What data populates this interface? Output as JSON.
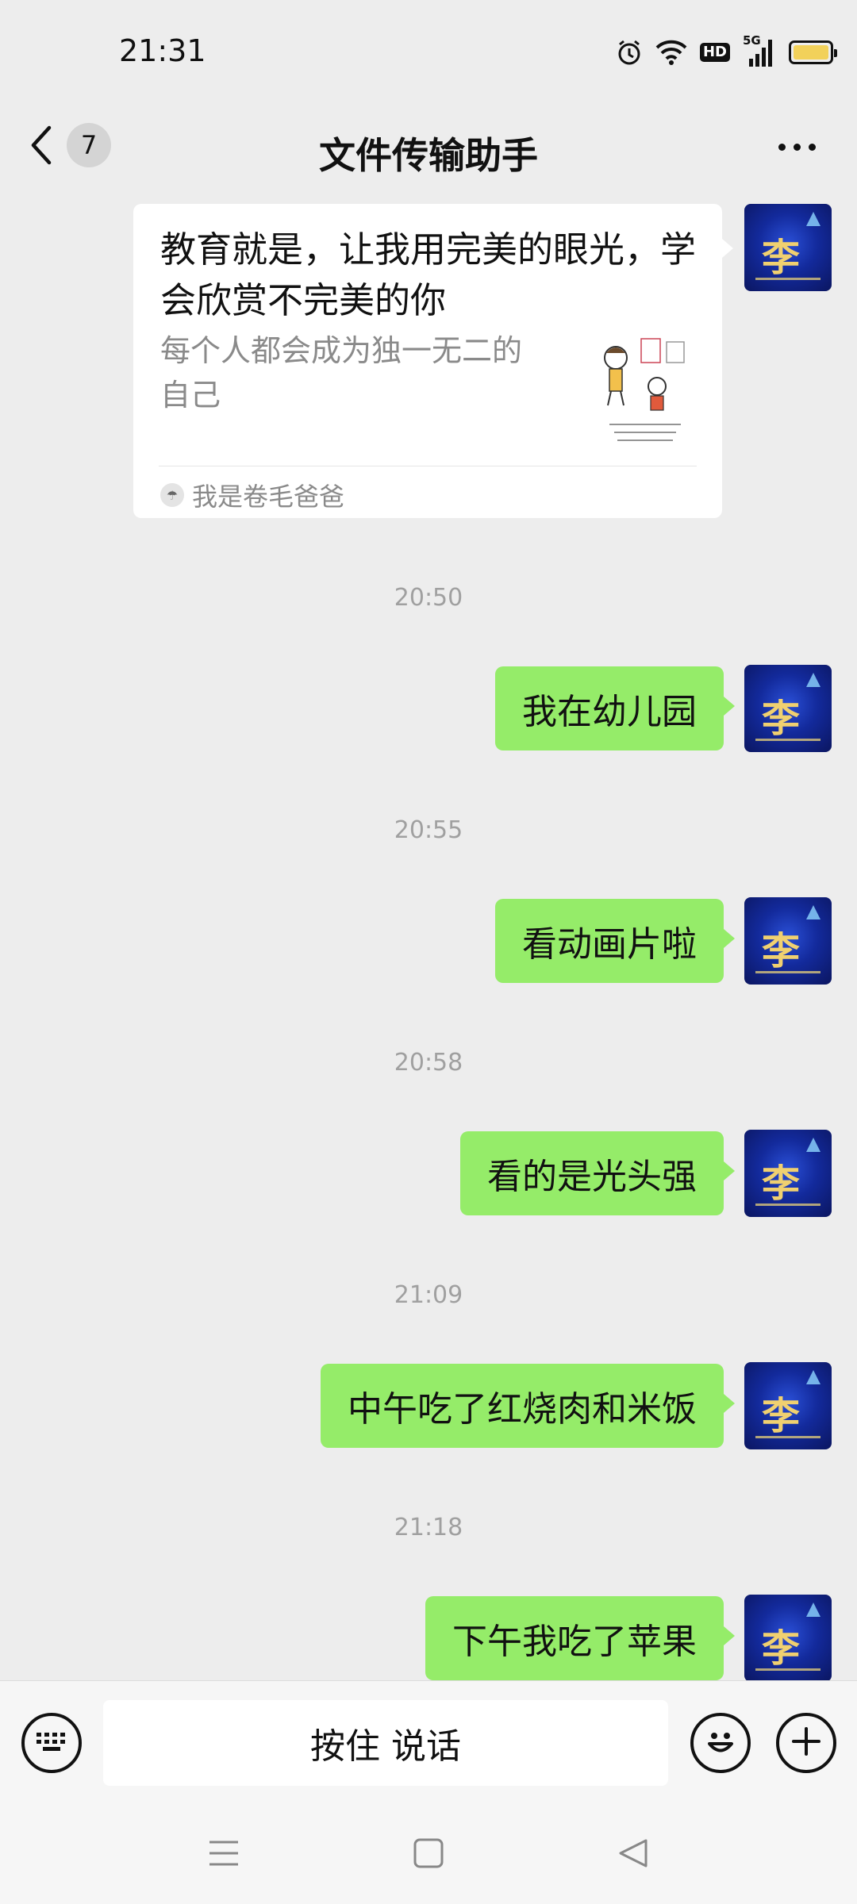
{
  "status_bar": {
    "time": "21:31",
    "hd_label": "HD",
    "network_label": "5G",
    "battery_color": "#f2d15a"
  },
  "nav": {
    "unread_count": "7",
    "title": "文件传输助手"
  },
  "link_card": {
    "title": "教育就是，让我用完美的眼光，学会欣赏不完美的你",
    "description": "每个人都会成为独一无二的自己",
    "source": "我是卷毛爸爸"
  },
  "messages": [
    {
      "time": "20:50",
      "text": "我在幼儿园"
    },
    {
      "time": "20:55",
      "text": "看动画片啦"
    },
    {
      "time": "20:58",
      "text": "看的是光头强"
    },
    {
      "time": "21:09",
      "text": "中午吃了红烧肉和米饭"
    },
    {
      "time": "21:18",
      "text": "下午我吃了苹果"
    }
  ],
  "input_bar": {
    "voice_label": "按住 说话"
  },
  "colors": {
    "outgoing_bubble": "#95ec69",
    "background": "#ededed"
  }
}
